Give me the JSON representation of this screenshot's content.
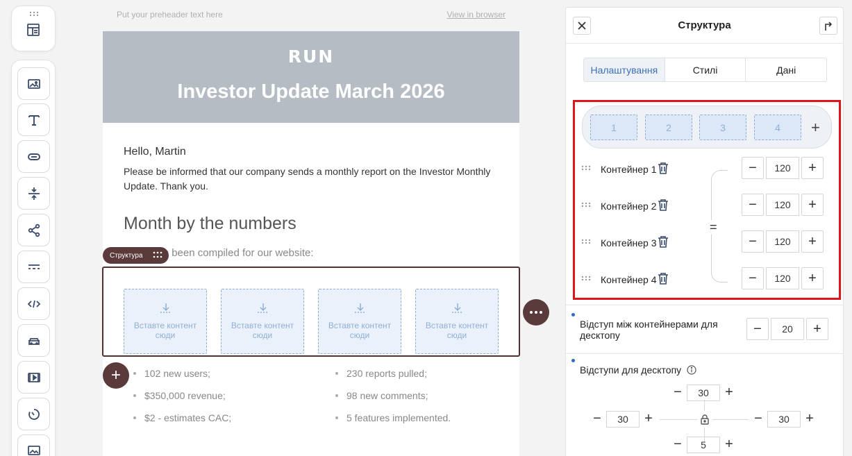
{
  "email": {
    "preheader": "Put your preheader text here",
    "view_in_browser": "View in browser",
    "logo": "RUN",
    "hero_title": "Investor Update March 2026",
    "greeting": "Hello, Martin",
    "paragraph": "Please be informed that our company sends a monthly report on the Investor Monthly Update. Thank you.",
    "section_title": "Month by the numbers",
    "subtitle": "dates has been compiled for our website:",
    "structure_tag": "Структура",
    "slot_text": "Вставте контент сюди",
    "list_left": [
      "102 new users;",
      "$350,000 revenue;",
      "$2 - estimates CAC;"
    ],
    "list_right": [
      "230 reports pulled;",
      "98 new comments;",
      "5 features implemented."
    ],
    "add_icon": "+"
  },
  "panel": {
    "title": "Структура",
    "tabs": [
      "Налаштування",
      "Стилі",
      "Дані"
    ],
    "columns": [
      "1",
      "2",
      "3",
      "4"
    ],
    "add_column": "+",
    "containers": [
      {
        "label": "Контейнер 1",
        "value": "120"
      },
      {
        "label": "Контейнер 2",
        "value": "120"
      },
      {
        "label": "Контейнер 3",
        "value": "120"
      },
      {
        "label": "Контейнер 4",
        "value": "120"
      }
    ],
    "equal_sign": "=",
    "gap_label": "Відступ між контейнерами для десктопу",
    "gap_value": "20",
    "padding_label": "Відступи для десктопу",
    "padding": {
      "top": "30",
      "left": "30",
      "right": "30",
      "bottom": "5"
    },
    "minus": "−",
    "plus": "+"
  },
  "colors": {
    "accent_brown": "#5a3a3a",
    "active_tab": "#3b6fb6",
    "highlight_red": "#e0141c",
    "hero_bg": "#b5bcc4"
  }
}
